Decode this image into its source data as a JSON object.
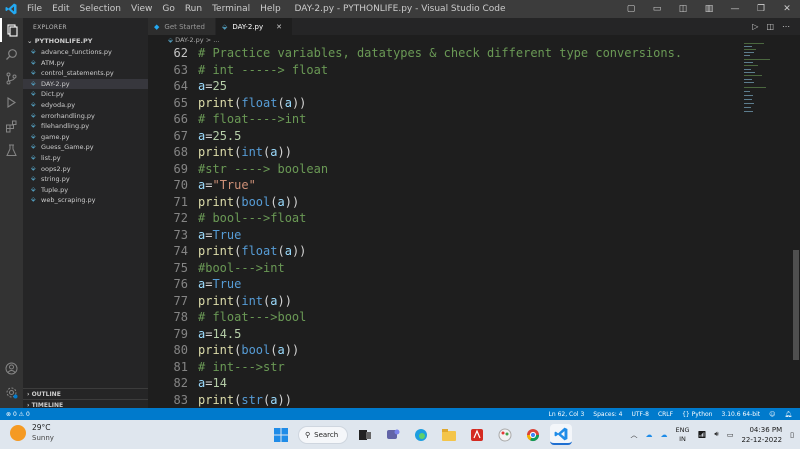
{
  "titlebar": {
    "menu": [
      "File",
      "Edit",
      "Selection",
      "View",
      "Go",
      "Run",
      "Terminal",
      "Help"
    ],
    "title": "DAY-2.py - PYTHONLIFE.py - Visual Studio Code"
  },
  "explorer": {
    "header": "EXPLORER",
    "folder": "PYTHONLIFE.PY",
    "files": [
      "advance_functions.py",
      "ATM.py",
      "control_statements.py",
      "DAY-2.py",
      "Dict.py",
      "edyoda.py",
      "errorhandling.py",
      "filehandling.py",
      "game.py",
      "Guess_Game.py",
      "list.py",
      "oops2.py",
      "string.py",
      "Tuple.py",
      "web_scraping.py"
    ],
    "selected": "DAY-2.py",
    "outline": "OUTLINE",
    "timeline": "TIMELINE"
  },
  "tabs": [
    {
      "label": "Get Started",
      "active": false
    },
    {
      "label": "DAY-2.py",
      "active": true
    }
  ],
  "breadcrumb": "DAY-2.py > ...",
  "editor": {
    "lines": [
      {
        "n": "62",
        "tokens": [
          [
            "c-com",
            "# Practice variables, datatypes & check different type conversions."
          ]
        ]
      },
      {
        "n": "63",
        "tokens": [
          [
            "c-com",
            "# int -----> float"
          ]
        ]
      },
      {
        "n": "64",
        "tokens": [
          [
            "c-var",
            "a"
          ],
          [
            "c-pun",
            "="
          ],
          [
            "c-num",
            "25"
          ]
        ]
      },
      {
        "n": "65",
        "tokens": [
          [
            "c-fn",
            "print"
          ],
          [
            "c-pun",
            "("
          ],
          [
            "c-kw",
            "float"
          ],
          [
            "c-pun",
            "("
          ],
          [
            "c-var",
            "a"
          ],
          [
            "c-pun",
            "))"
          ]
        ]
      },
      {
        "n": "66",
        "tokens": [
          [
            "c-com",
            "# float---->int"
          ]
        ]
      },
      {
        "n": "67",
        "tokens": [
          [
            "c-var",
            "a"
          ],
          [
            "c-pun",
            "="
          ],
          [
            "c-num",
            "25.5"
          ]
        ]
      },
      {
        "n": "68",
        "tokens": [
          [
            "c-fn",
            "print"
          ],
          [
            "c-pun",
            "("
          ],
          [
            "c-kw",
            "int"
          ],
          [
            "c-pun",
            "("
          ],
          [
            "c-var",
            "a"
          ],
          [
            "c-pun",
            "))"
          ]
        ]
      },
      {
        "n": "69",
        "tokens": [
          [
            "c-com",
            "#str ----> boolean"
          ]
        ]
      },
      {
        "n": "70",
        "tokens": [
          [
            "c-var",
            "a"
          ],
          [
            "c-pun",
            "="
          ],
          [
            "c-str",
            "\"True\""
          ]
        ]
      },
      {
        "n": "71",
        "tokens": [
          [
            "c-fn",
            "print"
          ],
          [
            "c-pun",
            "("
          ],
          [
            "c-kw",
            "bool"
          ],
          [
            "c-pun",
            "("
          ],
          [
            "c-var",
            "a"
          ],
          [
            "c-pun",
            "))"
          ]
        ]
      },
      {
        "n": "72",
        "tokens": [
          [
            "c-com",
            "# bool--->float"
          ]
        ]
      },
      {
        "n": "73",
        "tokens": [
          [
            "c-var",
            "a"
          ],
          [
            "c-pun",
            "="
          ],
          [
            "c-kw",
            "True"
          ]
        ]
      },
      {
        "n": "74",
        "tokens": [
          [
            "c-fn",
            "print"
          ],
          [
            "c-pun",
            "("
          ],
          [
            "c-kw",
            "float"
          ],
          [
            "c-pun",
            "("
          ],
          [
            "c-var",
            "a"
          ],
          [
            "c-pun",
            "))"
          ]
        ]
      },
      {
        "n": "75",
        "tokens": [
          [
            "c-com",
            "#bool--->int"
          ]
        ]
      },
      {
        "n": "76",
        "tokens": [
          [
            "c-var",
            "a"
          ],
          [
            "c-pun",
            "="
          ],
          [
            "c-kw",
            "True"
          ]
        ]
      },
      {
        "n": "77",
        "tokens": [
          [
            "c-fn",
            "print"
          ],
          [
            "c-pun",
            "("
          ],
          [
            "c-kw",
            "int"
          ],
          [
            "c-pun",
            "("
          ],
          [
            "c-var",
            "a"
          ],
          [
            "c-pun",
            "))"
          ]
        ]
      },
      {
        "n": "78",
        "tokens": [
          [
            "c-com",
            "# float--->bool"
          ]
        ]
      },
      {
        "n": "79",
        "tokens": [
          [
            "c-var",
            "a"
          ],
          [
            "c-pun",
            "="
          ],
          [
            "c-num",
            "14.5"
          ]
        ]
      },
      {
        "n": "80",
        "tokens": [
          [
            "c-fn",
            "print"
          ],
          [
            "c-pun",
            "("
          ],
          [
            "c-kw",
            "bool"
          ],
          [
            "c-pun",
            "("
          ],
          [
            "c-var",
            "a"
          ],
          [
            "c-pun",
            "))"
          ]
        ]
      },
      {
        "n": "81",
        "tokens": [
          [
            "c-com",
            "# int--->str"
          ]
        ]
      },
      {
        "n": "82",
        "tokens": [
          [
            "c-var",
            "a"
          ],
          [
            "c-pun",
            "="
          ],
          [
            "c-num",
            "14"
          ]
        ]
      },
      {
        "n": "83",
        "tokens": [
          [
            "c-fn",
            "print"
          ],
          [
            "c-pun",
            "("
          ],
          [
            "c-kw",
            "str"
          ],
          [
            "c-pun",
            "("
          ],
          [
            "c-var",
            "a"
          ],
          [
            "c-pun",
            "))"
          ]
        ]
      }
    ]
  },
  "statusbar": {
    "problems": "0 ⚠ 0",
    "position": "Ln 62, Col 3",
    "spaces": "Spaces: 4",
    "encoding": "UTF-8",
    "eol": "CRLF",
    "language": "Python",
    "interpreter": "3.10.6 64-bit"
  },
  "taskbar": {
    "weather_temp": "29°C",
    "weather_desc": "Sunny",
    "search_label": "Search",
    "lang_line1": "ENG",
    "lang_line2": "IN",
    "time": "04:36 PM",
    "date": "22-12-2022"
  }
}
